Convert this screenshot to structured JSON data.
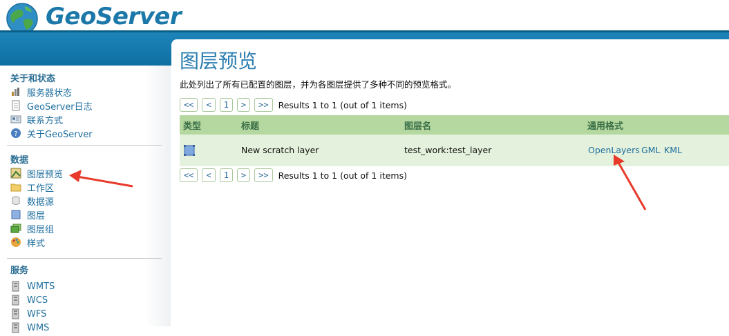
{
  "header": {
    "logo_text": "GeoServer"
  },
  "sidebar": {
    "sections": [
      {
        "title": "关于和状态",
        "items": [
          {
            "label": "服务器状态",
            "icon": "server-status-icon"
          },
          {
            "label": "GeoServer日志",
            "icon": "log-document-icon"
          },
          {
            "label": "联系方式",
            "icon": "contact-card-icon"
          },
          {
            "label": "关于GeoServer",
            "icon": "info-globe-icon"
          }
        ]
      },
      {
        "title": "数据",
        "items": [
          {
            "label": "图层预览",
            "icon": "layer-preview-icon"
          },
          {
            "label": "工作区",
            "icon": "folder-icon"
          },
          {
            "label": "数据源",
            "icon": "database-icon"
          },
          {
            "label": "图层",
            "icon": "layer-icon"
          },
          {
            "label": "图层组",
            "icon": "layer-group-icon"
          },
          {
            "label": "样式",
            "icon": "palette-icon"
          }
        ]
      },
      {
        "title": "服务",
        "items": [
          {
            "label": "WMTS",
            "icon": "service-icon"
          },
          {
            "label": "WCS",
            "icon": "service-icon"
          },
          {
            "label": "WFS",
            "icon": "service-icon"
          },
          {
            "label": "WMS",
            "icon": "service-icon"
          }
        ]
      }
    ]
  },
  "main": {
    "title": "图层预览",
    "description": "此处列出了所有已配置的图层，并为各图层提供了多种不同的预览格式。",
    "pager": {
      "first": "<<",
      "prev": "<",
      "page": "1",
      "next": ">",
      "last": ">>",
      "info": "Results 1 to 1 (out of 1 items)"
    },
    "table": {
      "headers": [
        "类型",
        "标题",
        "图层名",
        "通用格式"
      ],
      "rows": [
        {
          "type_icon": "polygon-layer-icon",
          "title": "New scratch layer",
          "name": "test_work:test_layer",
          "formats": [
            "OpenLayers",
            "GML",
            "KML"
          ]
        }
      ]
    }
  },
  "colors": {
    "brand_blue": "#1b78a8",
    "banner": "#1379ad",
    "table_header": "#b4d8a0",
    "table_row": "#e4f1dc",
    "link": "#1d6e9e",
    "annotation_arrow": "#e8392a"
  }
}
